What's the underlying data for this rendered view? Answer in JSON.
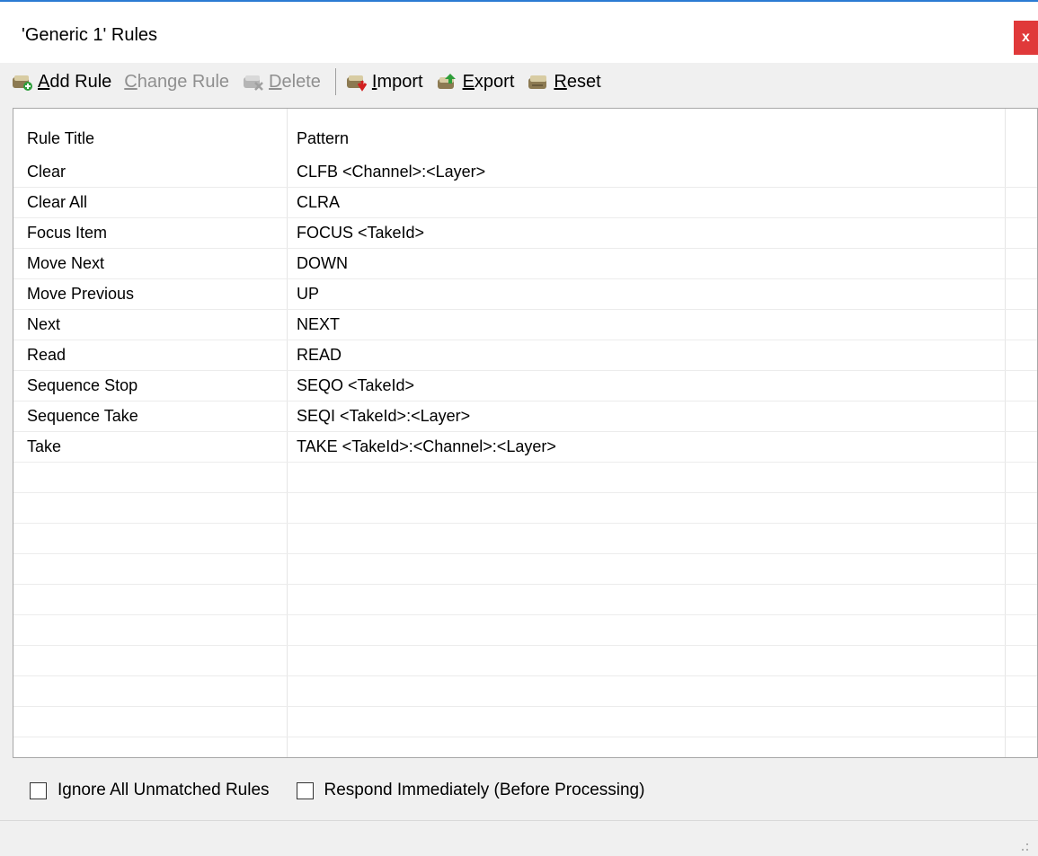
{
  "window": {
    "title": "'Generic 1' Rules",
    "close_label": "x"
  },
  "toolbar": {
    "add_rule": {
      "mnemonic": "A",
      "rest": "dd Rule"
    },
    "change_rule": {
      "mnemonic": "C",
      "rest": "hange Rule"
    },
    "delete": {
      "mnemonic": "D",
      "rest": "elete"
    },
    "import": {
      "mnemonic": "I",
      "rest": "mport"
    },
    "export": {
      "mnemonic": "E",
      "rest": "xport"
    },
    "reset": {
      "mnemonic": "R",
      "rest": "eset"
    }
  },
  "grid": {
    "columns": [
      "Rule Title",
      "Pattern"
    ],
    "rows": [
      [
        "Clear",
        "CLFB <Channel>:<Layer>"
      ],
      [
        "Clear All",
        "CLRA"
      ],
      [
        "Focus Item",
        "FOCUS <TakeId>"
      ],
      [
        "Move Next",
        "DOWN"
      ],
      [
        "Move Previous",
        "UP"
      ],
      [
        "Next",
        "NEXT"
      ],
      [
        "Read",
        "READ"
      ],
      [
        "Sequence Stop",
        "SEQO <TakeId>"
      ],
      [
        "Sequence Take",
        "SEQI <TakeId>:<Layer>"
      ],
      [
        "Take",
        "TAKE <TakeId>:<Channel>:<Layer>"
      ]
    ],
    "empty_rows": 10
  },
  "options": {
    "ignore_unmatched": {
      "label": "Ignore All Unmatched Rules",
      "checked": false
    },
    "respond_immediately": {
      "label": "Respond Immediately (Before Processing)",
      "checked": false
    }
  },
  "icons": {
    "add": "add-rule-icon",
    "change": "change-rule-icon",
    "delete": "delete-rule-icon",
    "import": "import-icon",
    "export": "export-icon",
    "reset": "reset-icon"
  }
}
